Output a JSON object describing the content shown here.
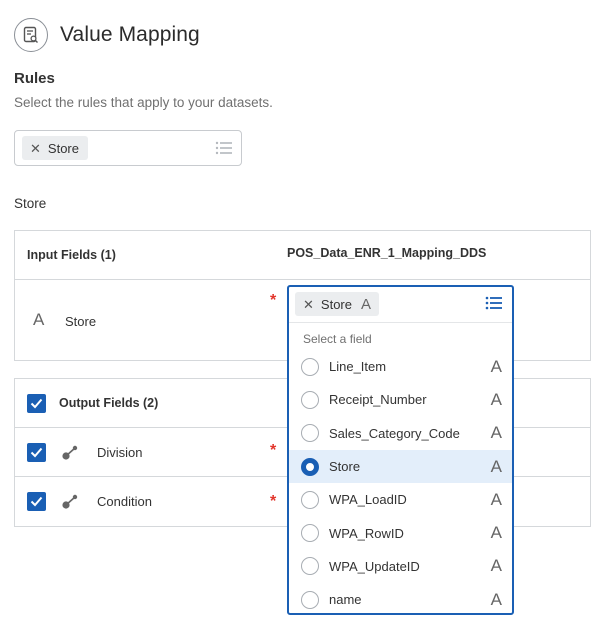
{
  "header": {
    "title": "Value Mapping",
    "icon": "document-search-icon"
  },
  "rules": {
    "heading": "Rules",
    "description": "Select the rules that apply to your datasets.",
    "selected_chip": "Store"
  },
  "section": {
    "label": "Store"
  },
  "input_fields": {
    "header_label": "Input Fields (1)",
    "dataset": "POS_Data_ENR_1_Mapping_DDS",
    "row_label": "Store",
    "type_glyph": "A"
  },
  "output_fields": {
    "header_label": "Output Fields (2)",
    "rows": [
      {
        "label": "Division"
      },
      {
        "label": "Condition"
      }
    ]
  },
  "dropdown": {
    "selected_chip": "Store",
    "chip_glyph": "A",
    "hint": "Select a field",
    "options": [
      {
        "label": "Line_Item",
        "type": "A"
      },
      {
        "label": "Receipt_Number",
        "type": "A"
      },
      {
        "label": "Sales_Category_Code",
        "type": "A"
      },
      {
        "label": "Store",
        "type": "A"
      },
      {
        "label": "WPA_LoadID",
        "type": "A"
      },
      {
        "label": "WPA_RowID",
        "type": "A"
      },
      {
        "label": "WPA_UpdateID",
        "type": "A"
      },
      {
        "label": "name",
        "type": "A"
      }
    ],
    "selected_index": 3
  },
  "required_marker": "*",
  "colors": {
    "accent": "#1a5fb4",
    "required": "#e2352b",
    "selected_bg": "#e3eefa"
  }
}
